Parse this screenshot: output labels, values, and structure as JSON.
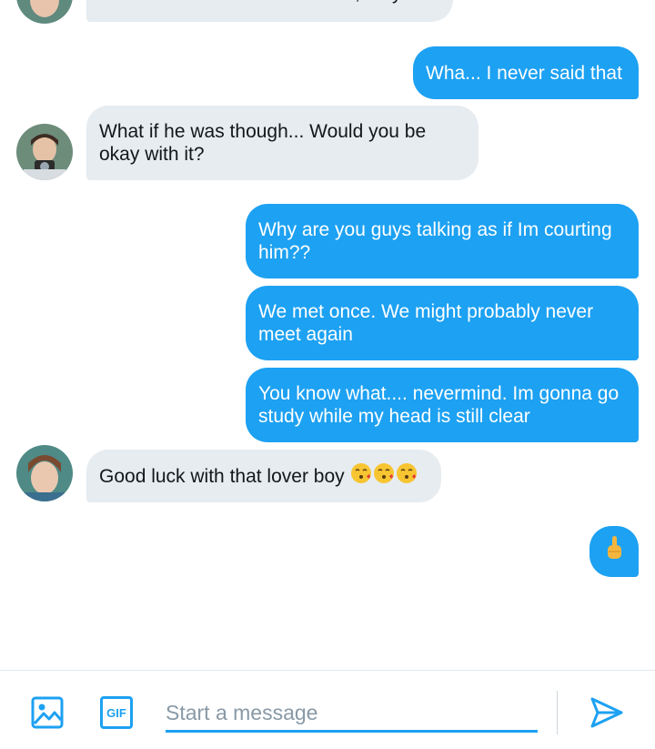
{
  "messages": [
    {
      "side": "in",
      "text": "You don't want him to be a fan, do you?"
    },
    {
      "side": "out",
      "text": "Wha... I never said that"
    },
    {
      "side": "in",
      "text": "What if he was though... Would you be okay with it?"
    },
    {
      "side": "out",
      "text": "Why are you guys talking as if Im courting him??"
    },
    {
      "side": "out",
      "text": "We met once. We might probably never meet again"
    },
    {
      "side": "out",
      "text": "You know what.... nevermind. Im gonna go study while my head is still clear"
    },
    {
      "side": "in",
      "text": "Good luck with that lover boy"
    },
    {
      "side": "out",
      "text": "",
      "emoji": "pointing-up-hand"
    }
  ],
  "reply_emojis": [
    "kissing-face-heart",
    "kissing-face-heart",
    "kissing-face-heart"
  ],
  "composer": {
    "placeholder": "Start a message",
    "gif_label": "GIF",
    "icons": [
      "image-icon",
      "gif-icon",
      "send-icon"
    ]
  },
  "colors": {
    "accent": "#1da1f2",
    "incoming_bubble": "#e6ecf0",
    "text": "#14171a",
    "placeholder": "#8899a6"
  }
}
